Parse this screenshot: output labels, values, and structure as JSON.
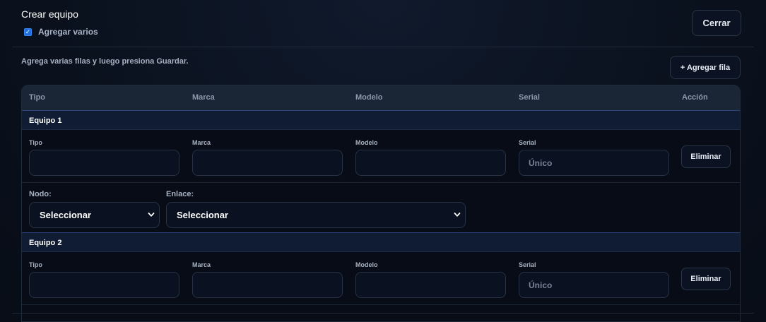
{
  "modal": {
    "title": "Crear equipo",
    "multi_checkbox_label": "Agregar varios",
    "multi_checked": true,
    "close_label": "Cerrar",
    "hint": "Agrega varias filas y luego presiona Guardar.",
    "add_row_label": "+ Agregar fila"
  },
  "table": {
    "headers": [
      "Tipo",
      "Marca",
      "Modelo",
      "Serial",
      "Acción"
    ],
    "groups": [
      {
        "title": "Equipo 1",
        "fields": {
          "tipo_label": "Tipo",
          "tipo_value": "",
          "marca_label": "Marca",
          "marca_value": "",
          "modelo_label": "Modelo",
          "modelo_value": "",
          "serial_label": "Serial",
          "serial_placeholder": "Único"
        },
        "delete_label": "Eliminar",
        "nodo_label": "Nodo:",
        "nodo_value": "Seleccionar",
        "enlace_label": "Enlace:",
        "enlace_value": "Seleccionar"
      },
      {
        "title": "Equipo 2",
        "fields": {
          "tipo_label": "Tipo",
          "tipo_value": "",
          "marca_label": "Marca",
          "marca_value": "",
          "modelo_label": "Modelo",
          "modelo_value": "",
          "serial_label": "Serial",
          "serial_placeholder": "Único"
        },
        "delete_label": "Eliminar"
      }
    ]
  },
  "colors": {
    "background": "#0b1220",
    "accent": "#1f6fe0",
    "group_header": "#0f1c33",
    "border": "#273246"
  }
}
